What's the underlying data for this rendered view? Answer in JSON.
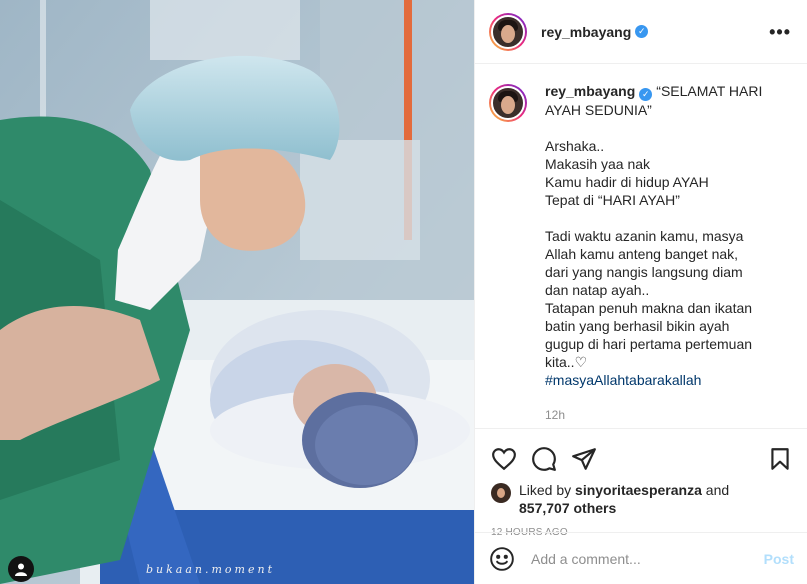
{
  "post": {
    "username": "rey_mbayang",
    "watermark": "bukaan.moment"
  },
  "caption": {
    "username": "rey_mbayang",
    "title": "“SELAMAT HARI AYAH SEDUNIA”",
    "lines1": [
      "Arshaka..",
      "Makasih yaa nak",
      "Kamu hadir di hidup AYAH",
      "Tepat di “HARI AYAH”"
    ],
    "lines2": [
      "Tadi waktu azanin kamu, masya Allah kamu anteng banget nak, dari yang nangis langsung diam dan natap ayah..",
      "Tatapan penuh makna dan ikatan batin yang berhasil bikin ayah gugup di hari pertama pertemuan kita..♡"
    ],
    "hashtag": "#masyaAllahtabarakallah",
    "time": "12h"
  },
  "likes": {
    "prefix": "Liked by",
    "user": "sinyoritaesperanza",
    "conjunction": "and",
    "count": "857,707 others"
  },
  "timestamp": "12 HOURS AGO",
  "comment": {
    "placeholder": "Add a comment...",
    "post_label": "Post"
  },
  "icons": {
    "verified": "verified-badge-icon",
    "more": "more-options-icon",
    "like": "heart-icon",
    "comment": "comment-bubble-icon",
    "share": "paper-plane-icon",
    "save": "bookmark-icon",
    "emoji": "smiley-icon",
    "tag": "user-tag-icon"
  },
  "colors": {
    "verified": "#3897f0",
    "hashtag": "#00376b",
    "muted": "#8e8e8e",
    "post_disabled": "#b2dffc"
  }
}
